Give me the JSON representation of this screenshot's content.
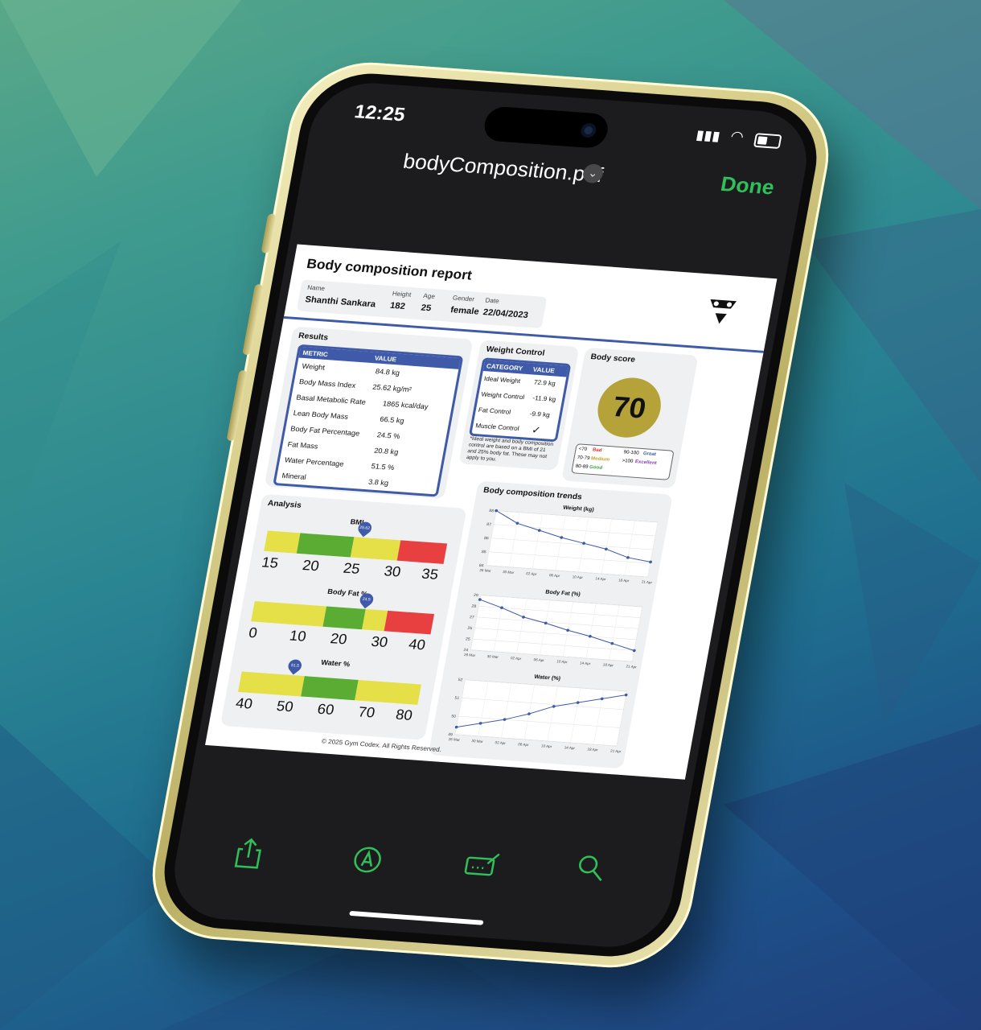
{
  "status": {
    "time": "12:25"
  },
  "nav": {
    "filename": "bodyComposition.pdf",
    "done_label": "Done"
  },
  "report": {
    "title": "Body composition report",
    "info": {
      "name_label": "Name",
      "name": "Shanthi Sankara",
      "height_label": "Height",
      "height": "182",
      "age_label": "Age",
      "age": "25",
      "gender_label": "Gender",
      "gender": "female",
      "date_label": "Date",
      "date": "22/04/2023"
    },
    "results": {
      "title": "Results",
      "header": {
        "metric": "METRIC",
        "value": "VALUE"
      },
      "rows": [
        {
          "metric": "Weight",
          "value": "84.8 kg"
        },
        {
          "metric": "Body Mass Index",
          "value": "25.62 kg/m²"
        },
        {
          "metric": "Basal Metabolic Rate",
          "value": "1865 kcal/day"
        },
        {
          "metric": "Lean Body Mass",
          "value": "66.5 kg"
        },
        {
          "metric": "Body Fat Percentage",
          "value": "24.5 %"
        },
        {
          "metric": "Fat Mass",
          "value": "20.8 kg"
        },
        {
          "metric": "Water Percentage",
          "value": "51.5 %"
        },
        {
          "metric": "Mineral",
          "value": "3.8 kg"
        }
      ]
    },
    "weight_control": {
      "title": "Weight Control",
      "header": {
        "category": "CATEGORY",
        "value": "VALUE"
      },
      "rows": [
        {
          "category": "Ideal Weight",
          "value": "72.9 kg"
        },
        {
          "category": "Weight Control",
          "value": "-11.9 kg"
        },
        {
          "category": "Fat Control",
          "value": "-9.9 kg"
        },
        {
          "category": "Muscle Control",
          "value": "✓"
        }
      ],
      "note": "*Ideal weight and body composition control are based on a BMI of 21 and 25% body fat. These may not apply to you."
    },
    "body_score": {
      "title": "Body score",
      "score": "70",
      "legend": {
        "r1a_range": "<70",
        "r1a_label": "Bad",
        "r1b_range": "90-100",
        "r1b_label": "Great",
        "r2a_range": "70-79",
        "r2a_label": "Medium",
        "r2b_range": ">100",
        "r2b_label": "Excellent",
        "r3a_range": "80-89",
        "r3a_label": "Good"
      },
      "colors": {
        "bad": "#e03030",
        "great": "#3f5aa8",
        "medium": "#c8a020",
        "excellent": "#8a3fb0",
        "good": "#3aa040"
      }
    },
    "analysis": {
      "title": "Analysis",
      "bmi": {
        "title": "BMI",
        "marker": "25.62",
        "ticks": [
          "15",
          "20",
          "25",
          "30",
          "35"
        ],
        "value": 25.62,
        "min": 15,
        "max": 35
      },
      "bodyfat": {
        "title": "Body Fat %",
        "marker": "24.5",
        "ticks": [
          "0",
          "10",
          "20",
          "30",
          "40"
        ],
        "value": 24.5,
        "min": 0,
        "max": 40
      },
      "water": {
        "title": "Water %",
        "marker": "51.5",
        "ticks": [
          "40",
          "50",
          "60",
          "70",
          "80"
        ],
        "value": 51.5,
        "min": 40,
        "max": 80
      }
    },
    "trends_title": "Body composition trends",
    "footer": "© 2025 Gym Codex. All Rights Reserved."
  },
  "chart_data": [
    {
      "type": "line",
      "title": "Weight (kg)",
      "x": [
        "26 Mar",
        "30 Mar",
        "02 Apr",
        "06 Apr",
        "10 Apr",
        "14 Apr",
        "18 Apr",
        "21 Apr"
      ],
      "y_ticks": [
        "84",
        "85",
        "86",
        "87",
        "88"
      ],
      "ylim": [
        84,
        88
      ],
      "series": [
        {
          "values": [
            88.0,
            87.2,
            86.8,
            86.4,
            86.1,
            85.8,
            85.3,
            85.1
          ]
        }
      ]
    },
    {
      "type": "line",
      "title": "Body Fat (%)",
      "x": [
        "26 Mar",
        "30 Mar",
        "02 Apr",
        "06 Apr",
        "10 Apr",
        "14 Apr",
        "18 Apr",
        "21 Apr"
      ],
      "y_ticks": [
        "24",
        "25",
        "26",
        "27",
        "28",
        "29"
      ],
      "ylim": [
        24,
        29
      ],
      "series": [
        {
          "values": [
            28.6,
            28.0,
            27.3,
            26.9,
            26.4,
            26.0,
            25.5,
            25.0
          ]
        }
      ]
    },
    {
      "type": "line",
      "title": "Water (%)",
      "x": [
        "26 Mar",
        "30 Mar",
        "02 Apr",
        "06 Apr",
        "10 Apr",
        "14 Apr",
        "18 Apr",
        "21 Apr"
      ],
      "y_ticks": [
        "49",
        "50",
        "51",
        "52"
      ],
      "ylim": [
        49,
        52
      ],
      "series": [
        {
          "values": [
            49.4,
            49.7,
            50.0,
            50.4,
            50.9,
            51.2,
            51.5,
            51.8
          ]
        }
      ]
    }
  ]
}
